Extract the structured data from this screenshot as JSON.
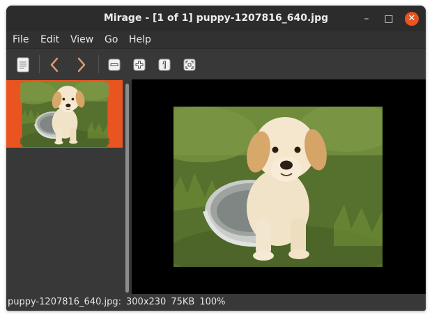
{
  "window": {
    "title": "Mirage - [1 of 1] puppy-1207816_640.jpg"
  },
  "controls": {
    "minimize": "–",
    "maximize": "□",
    "close": "✕"
  },
  "menu": [
    "File",
    "Edit",
    "View",
    "Go",
    "Help"
  ],
  "toolbar": {
    "buttons": [
      {
        "name": "image-properties-icon"
      },
      {
        "name": "previous-image-icon"
      },
      {
        "name": "next-image-icon"
      },
      {
        "name": "zoom-out-icon"
      },
      {
        "name": "zoom-in-icon"
      },
      {
        "name": "zoom-1-to-1-icon"
      },
      {
        "name": "zoom-to-fit-icon"
      }
    ]
  },
  "thumbnails": [
    {
      "selected": true
    }
  ],
  "status": {
    "filename": "puppy-1207816_640.jpg:",
    "dimensions": "300x230",
    "filesize": "75KB",
    "zoom": "100%"
  },
  "colors": {
    "accent": "#e95420",
    "viewer_bg": "#000000",
    "window_bg": "#383838"
  }
}
